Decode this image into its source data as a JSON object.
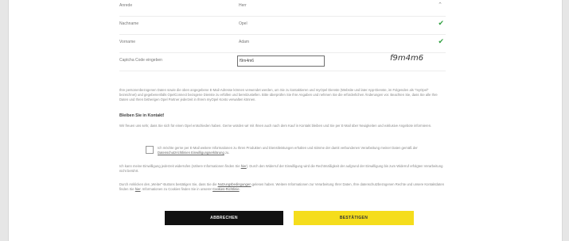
{
  "form": {
    "fields": [
      {
        "label": "Anrede",
        "value": "Herr",
        "control": "select"
      },
      {
        "label": "Nachname",
        "value": "Opel",
        "status": "✔"
      },
      {
        "label": "Vorname",
        "value": "Adam",
        "status": "✔"
      }
    ],
    "captcha": {
      "label": "Captcha Code eingeben",
      "value": "f9m4m6",
      "code": "f9m4m6"
    }
  },
  "privacy_text": "Ihre personenbezogenen Daten sowie die oben angegebene E-Mail-Adresse können verwendet werden, um Sie zu kontaktieren und myOpel Dienste (Website und later App-Dienste, im Folgenden als \"myOpel\" bezeichnet) und gegebenenfalls OpelConnect bezogene Dienste zu erfüllen und bereitzustellen. Bitte überprüfen Sie Ihre Angaben und nehmen Sie die erforderlichen Änderungen vor. Beachten Sie, dass Sie alle Ihre Daten und Ihren bisherigen Opel Partner jederzeit in Ihrem myOpel Konto verwalten können.",
  "stay_in_touch": {
    "heading": "Bleiben Sie in Kontakt!",
    "text": "Wir freuen uns sehr, dass Sie sich für einen Opel entschieden haben. Gerne würden wir mit Ihnen auch nach dem Kauf in Kontakt bleiben und Sie per E-Mail über Neuigkeiten und exklusive Angebote informieren."
  },
  "consent": {
    "text_before": "Ich möchte gerne per E-Mail weitere Informationen zu Ihren Produkten und Dienstleistungen erhalten und stimme der damit verbundenen Verarbeitung meiner Daten gemäß der ",
    "link": "Datenschutzrichtlinien Einwilligungserklärung",
    "text_after": " zu."
  },
  "withdraw": {
    "before": "Ich kann meine Einwilligung jederzeit widerrufen (nähere Informationen finden Sie ",
    "link": "hier",
    "after": "). Durch den Widerruf der Einwilligung wird die Rechtmäßigkeit der aufgrund der Einwilligung bis zum Widerruf erfolgten Verarbeitung nicht berührt."
  },
  "terms": {
    "part1": "Durch Anklicken des „Weiter\"-Buttons bestätigen Sie, dass Sie die ",
    "link1": "Nutzungsbedingungen",
    "part2": " gelesen haben. Weitere Informationen zur Verarbeitung Ihrer Daten, Ihre datenschutzbezogenen Rechte und unsere Kontaktdaten finden Sie ",
    "link2": "hier",
    "part3": ". Informationen zu Cookies finden Sie in unserer ",
    "link3": "Cookies-Richtlinie",
    "part4": "."
  },
  "buttons": {
    "cancel": "ABBRECHEN",
    "confirm": "BESTÄTIGEN"
  }
}
